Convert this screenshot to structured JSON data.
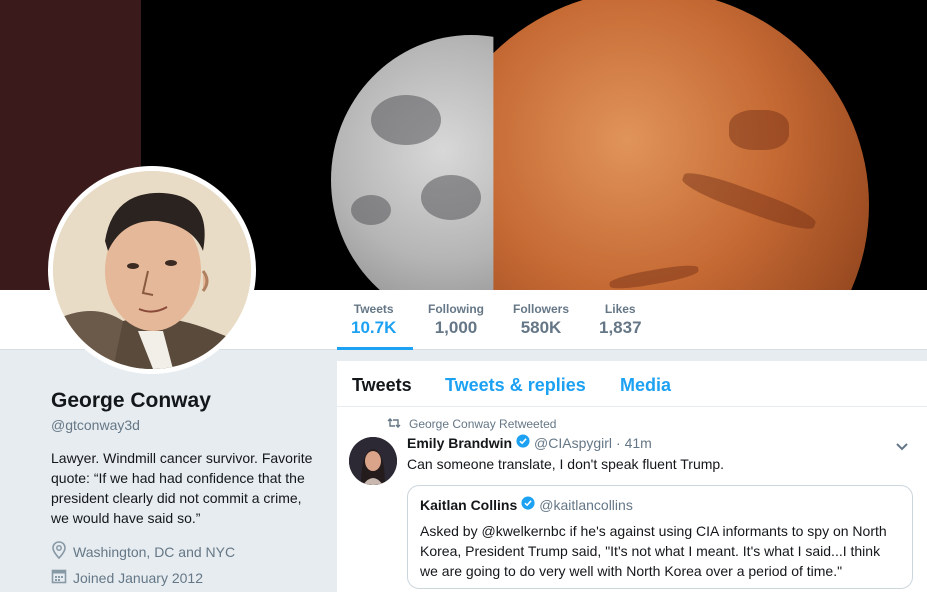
{
  "stats": [
    {
      "label": "Tweets",
      "value": "10.7K",
      "active": true
    },
    {
      "label": "Following",
      "value": "1,000"
    },
    {
      "label": "Followers",
      "value": "580K"
    },
    {
      "label": "Likes",
      "value": "1,837"
    }
  ],
  "profile": {
    "name": "George Conway",
    "handle": "@gtconway3d",
    "bio": "Lawyer. Windmill cancer survivor. Favorite quote: “If we had had confidence that the president clearly did not commit a crime, we would have said so.”",
    "location": "Washington, DC and NYC",
    "joined": "Joined January 2012"
  },
  "tabs": [
    {
      "label": "Tweets",
      "active": true
    },
    {
      "label": "Tweets & replies"
    },
    {
      "label": "Media"
    }
  ],
  "tweet": {
    "retweet_label": "George Conway Retweeted",
    "author_name": "Emily Brandwin",
    "author_handle": "@CIAspygirl",
    "time": "· 41m",
    "text": "Can someone translate, I don't speak fluent Trump.",
    "quote": {
      "author_name": "Kaitlan Collins",
      "author_handle": "@kaitlancollins",
      "text": "Asked by @kwelkernbc if he's against using CIA informants to spy on North Korea, President Trump said, \"It's not what I meant. It's what I said...I think we are going to do very well with North Korea over a period of time.\""
    }
  },
  "colors": {
    "accent": "#1da1f2",
    "text": "#14171a",
    "secondary": "#657786",
    "background": "#e6ecf0"
  },
  "icons": {
    "location": "map-pin-icon",
    "joined": "calendar-icon",
    "retweet": "retweet-icon",
    "verified": "verified-badge-icon",
    "more": "chevron-down-icon"
  }
}
